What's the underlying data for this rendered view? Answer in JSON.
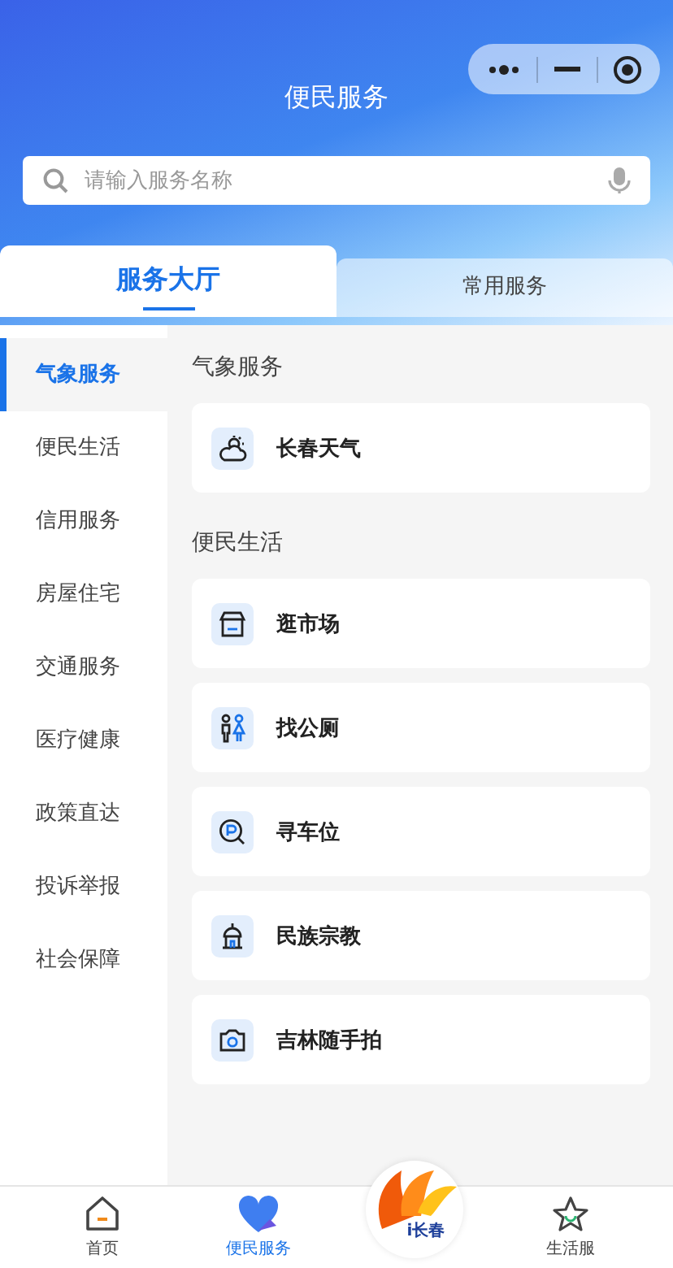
{
  "header": {
    "title": "便民服务"
  },
  "search": {
    "placeholder": "请输入服务名称"
  },
  "tabs": [
    {
      "label": "服务大厅",
      "selected": true
    },
    {
      "label": "常用服务",
      "selected": false
    }
  ],
  "sidebar": {
    "items": [
      {
        "label": "气象服务",
        "selected": true
      },
      {
        "label": "便民生活",
        "selected": false
      },
      {
        "label": "信用服务",
        "selected": false
      },
      {
        "label": "房屋住宅",
        "selected": false
      },
      {
        "label": "交通服务",
        "selected": false
      },
      {
        "label": "医疗健康",
        "selected": false
      },
      {
        "label": "政策直达",
        "selected": false
      },
      {
        "label": "投诉举报",
        "selected": false
      },
      {
        "label": "社会保障",
        "selected": false
      }
    ]
  },
  "sections": [
    {
      "title": "气象服务",
      "items": [
        {
          "label": "长春天气",
          "kind": "weather"
        }
      ]
    },
    {
      "title": "便民生活",
      "items": [
        {
          "label": "逛市场",
          "kind": "market"
        },
        {
          "label": "找公厕",
          "kind": "toilet"
        },
        {
          "label": "寻车位",
          "kind": "parking"
        },
        {
          "label": "民族宗教",
          "kind": "temple"
        },
        {
          "label": "吉林随手拍",
          "kind": "camera"
        }
      ]
    }
  ],
  "bottom_nav": {
    "items": [
      {
        "label": "首页",
        "kind": "home",
        "selected": false
      },
      {
        "label": "便民服务",
        "kind": "heart",
        "selected": true
      },
      {
        "label": "i长春",
        "kind": "logo",
        "selected": false
      },
      {
        "label": "生活服",
        "kind": "star",
        "selected": false
      }
    ]
  }
}
